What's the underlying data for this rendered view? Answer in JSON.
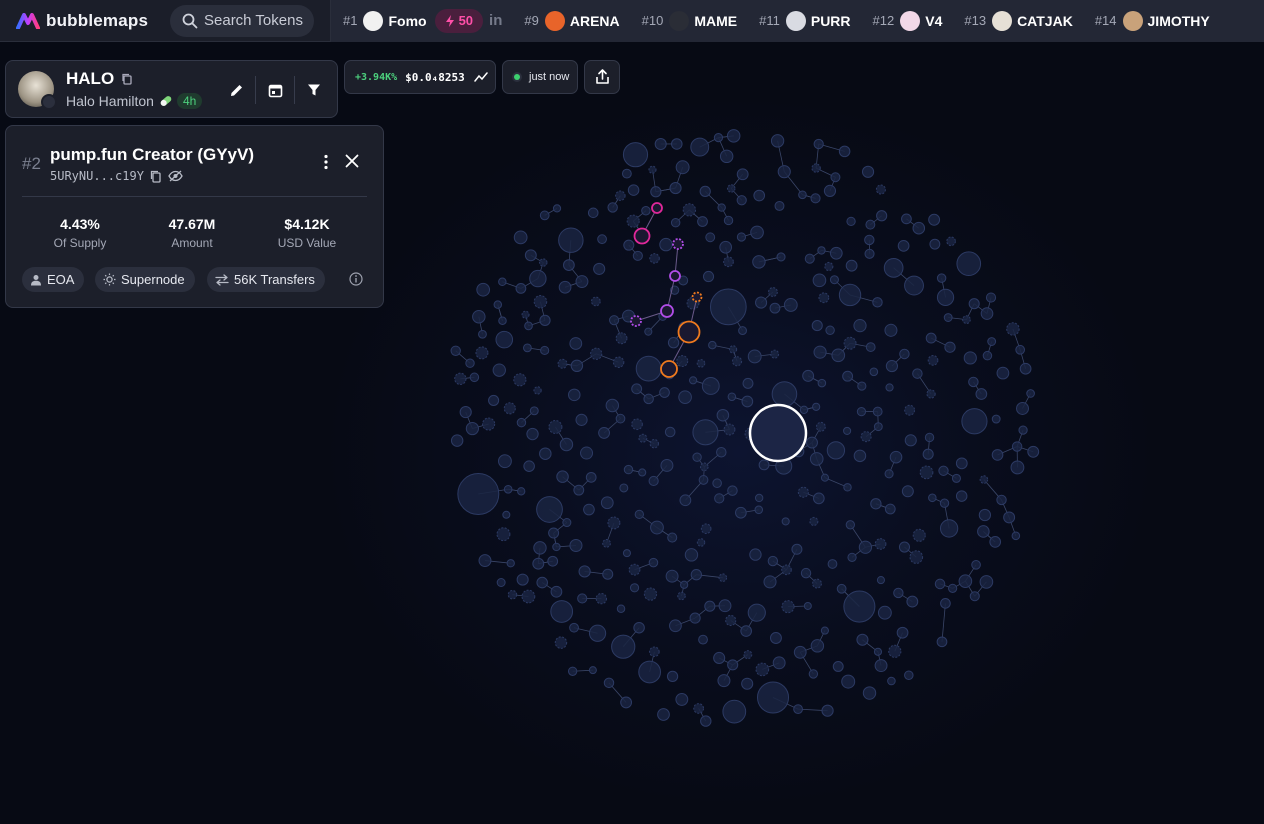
{
  "app": {
    "brand": "bubblemaps"
  },
  "search": {
    "placeholder": "Search Tokens"
  },
  "ticker": {
    "first": {
      "rank": "#1",
      "name": "Fomo",
      "badge": "50",
      "in_label": "in"
    },
    "items": [
      {
        "rank": "#9",
        "name": "ARENA",
        "avatar_color": "#e8642a"
      },
      {
        "rank": "#10",
        "name": "MAME",
        "avatar_color": "#2a2d36"
      },
      {
        "rank": "#11",
        "name": "PURR",
        "avatar_color": "#d9dbe2"
      },
      {
        "rank": "#12",
        "name": "V4",
        "avatar_color": "#f2d8e8"
      },
      {
        "rank": "#13",
        "name": "CATJAK",
        "avatar_color": "#e6e0d6"
      },
      {
        "rank": "#14",
        "name": "JIMOTHY",
        "avatar_color": "#c9a27a"
      }
    ]
  },
  "token": {
    "symbol": "HALO",
    "name": "Halo Hamilton",
    "age": "4h"
  },
  "price": {
    "change": "+3.94K%",
    "value": "$0.0₄8253"
  },
  "status": {
    "text": "just now"
  },
  "holder": {
    "rank": "#2",
    "title": "pump.fun Creator (GYyV)",
    "address": "5URyNU...c19Y",
    "stats": [
      {
        "value": "4.43%",
        "label": "Of Supply"
      },
      {
        "value": "47.67M",
        "label": "Amount"
      },
      {
        "value": "$4.12K",
        "label": "USD Value"
      }
    ],
    "tags": {
      "type": "EOA",
      "node": "Supernode",
      "transfers": "56K Transfers"
    }
  },
  "colors": {
    "accent_pink": "#ff4fa8",
    "positive_green": "#4cd07d",
    "bubble_fill": "#1a2442",
    "bubble_stroke": "#2c3a63",
    "highlight_magenta": "#e0289a",
    "highlight_purple": "#b14de8",
    "highlight_orange": "#f07a1e",
    "selected_ring": "#ffffff"
  }
}
